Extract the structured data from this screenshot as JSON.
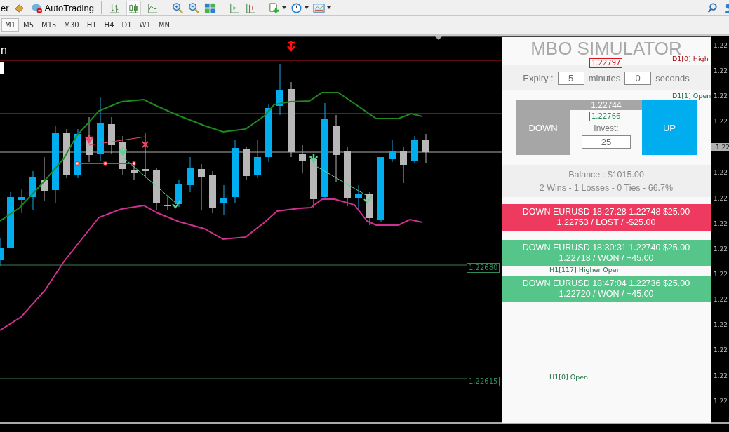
{
  "toolbar": {
    "leading_text": "er",
    "autotrading": "AutoTrading",
    "chart_type_buttons": [
      {
        "selected": false
      },
      {
        "selected": true
      },
      {
        "selected": false
      }
    ]
  },
  "timeframes": [
    {
      "label": "M1",
      "selected": true
    },
    {
      "label": "M5",
      "selected": false
    },
    {
      "label": "M15",
      "selected": false
    },
    {
      "label": "M30",
      "selected": false
    },
    {
      "label": "H1",
      "selected": false
    },
    {
      "label": "H4",
      "selected": false
    },
    {
      "label": "D1",
      "selected": false
    },
    {
      "label": "W1",
      "selected": false
    },
    {
      "label": "MN",
      "selected": false
    }
  ],
  "chart": {
    "symbol_fragment": "n",
    "levels": [
      {
        "price": "1.22797",
        "label": "D1[0] High",
        "kind": "high"
      },
      {
        "price": "1.22766",
        "label": "D1[1] Open",
        "kind": "open"
      },
      {
        "price": "1.22680",
        "label": "H1[117] Higher Open",
        "kind": "open"
      },
      {
        "price": "1.22615",
        "label": "H1[0] Open",
        "kind": "open"
      }
    ],
    "price_axis": [
      {
        "label": "1.22",
        "current": false
      },
      {
        "label": "1.22",
        "current": false
      },
      {
        "label": "1.22",
        "current": false
      },
      {
        "label": "1.22",
        "current": false
      },
      {
        "label": "1.22",
        "current": true
      },
      {
        "label": "1.22",
        "current": false
      },
      {
        "label": "1.22",
        "current": false
      },
      {
        "label": "1.22",
        "current": false
      },
      {
        "label": "1.22",
        "current": false
      },
      {
        "label": "1.22",
        "current": false
      },
      {
        "label": "1.22",
        "current": false
      },
      {
        "label": "1.22",
        "current": false
      },
      {
        "label": "1.22",
        "current": false
      },
      {
        "label": "1.22",
        "current": false
      },
      {
        "label": "1.22",
        "current": false
      }
    ]
  },
  "simulator": {
    "title": "MBO SIMULATOR",
    "expiry_label": "Expiry :",
    "minutes_value": "5",
    "minutes_label": "minutes",
    "seconds_value": "0",
    "seconds_label": "seconds",
    "down_button": "DOWN",
    "up_button": "UP",
    "current_price": "1.22744",
    "invest_label": "Invest:",
    "invest_value": "25",
    "balance": "Balance : $1015.00",
    "stats": "2 Wins - 1 Losses - 0 Ties - 66.7%",
    "trades": [
      {
        "line1": "DOWN EURUSD 18:27:28 1.22748 $25.00",
        "line2": "1.22753 / LOST / -$25.00",
        "kind": "lost"
      },
      {
        "line1": "DOWN EURUSD 18:30:31 1.22740 $25.00",
        "line2": "1.22718 / WON / +45.00",
        "kind": "won"
      },
      {
        "line1": "DOWN EURUSD 18:47:04 1.22736 $25.00",
        "line2": "1.22720 / WON / +45.00",
        "kind": "won"
      }
    ]
  }
}
